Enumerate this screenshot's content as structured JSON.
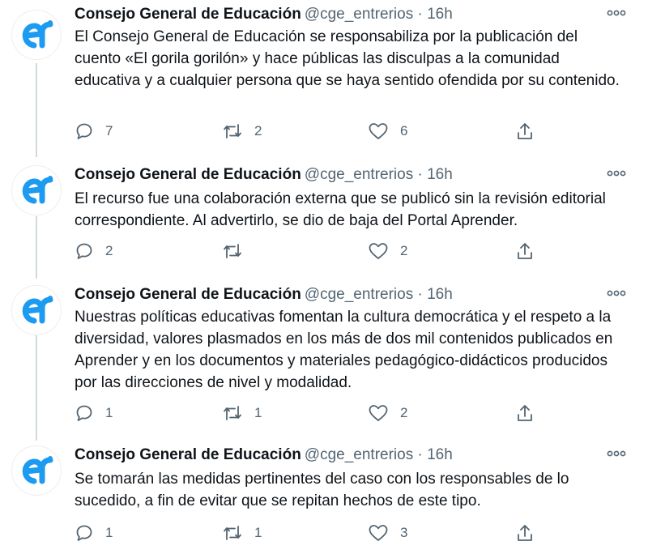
{
  "colors": {
    "brand": "#1d9bf0",
    "muted": "#536471",
    "text": "#0f1419",
    "line": "#cfd9de"
  },
  "icons": {
    "reply": "reply-icon",
    "retweet": "retweet-icon",
    "like": "heart-icon",
    "share": "share-icon",
    "more": "more-icon"
  },
  "tweets": [
    {
      "name": "Consejo General de Educación",
      "handle": "@cge_entrerios · 16h",
      "text": "El Consejo General de Educación se responsabiliza por la publicación del cuento «El gorila gorilón» y hace públicas las disculpas a la comunidad educativa y a cualquier persona que se haya sentido ofendida por su contenido.",
      "replies": "7",
      "retweets": "2",
      "likes": "6"
    },
    {
      "name": "Consejo General de Educación",
      "handle": "@cge_entrerios · 16h",
      "text": "El recurso fue una colaboración externa que se publicó sin la revisión editorial correspondiente. Al advertirlo, se dio de baja del Portal Aprender.",
      "replies": "2",
      "retweets": "",
      "likes": "2"
    },
    {
      "name": "Consejo General de Educación",
      "handle": "@cge_entrerios · 16h",
      "text": "Nuestras políticas educativas fomentan la cultura democrática y el respeto a la diversidad, valores plasmados en los más de dos mil contenidos publicados en Aprender y en los documentos y materiales pedagógico-didácticos producidos por las direcciones de nivel y modalidad.",
      "replies": "1",
      "retweets": "1",
      "likes": "2"
    },
    {
      "name": "Consejo General de Educación",
      "handle": "@cge_entrerios · 16h",
      "text": "Se tomarán las medidas pertinentes del caso con los responsables de lo sucedido, a fin de evitar que se repitan hechos de este tipo.",
      "replies": "1",
      "retweets": "1",
      "likes": "3"
    }
  ]
}
